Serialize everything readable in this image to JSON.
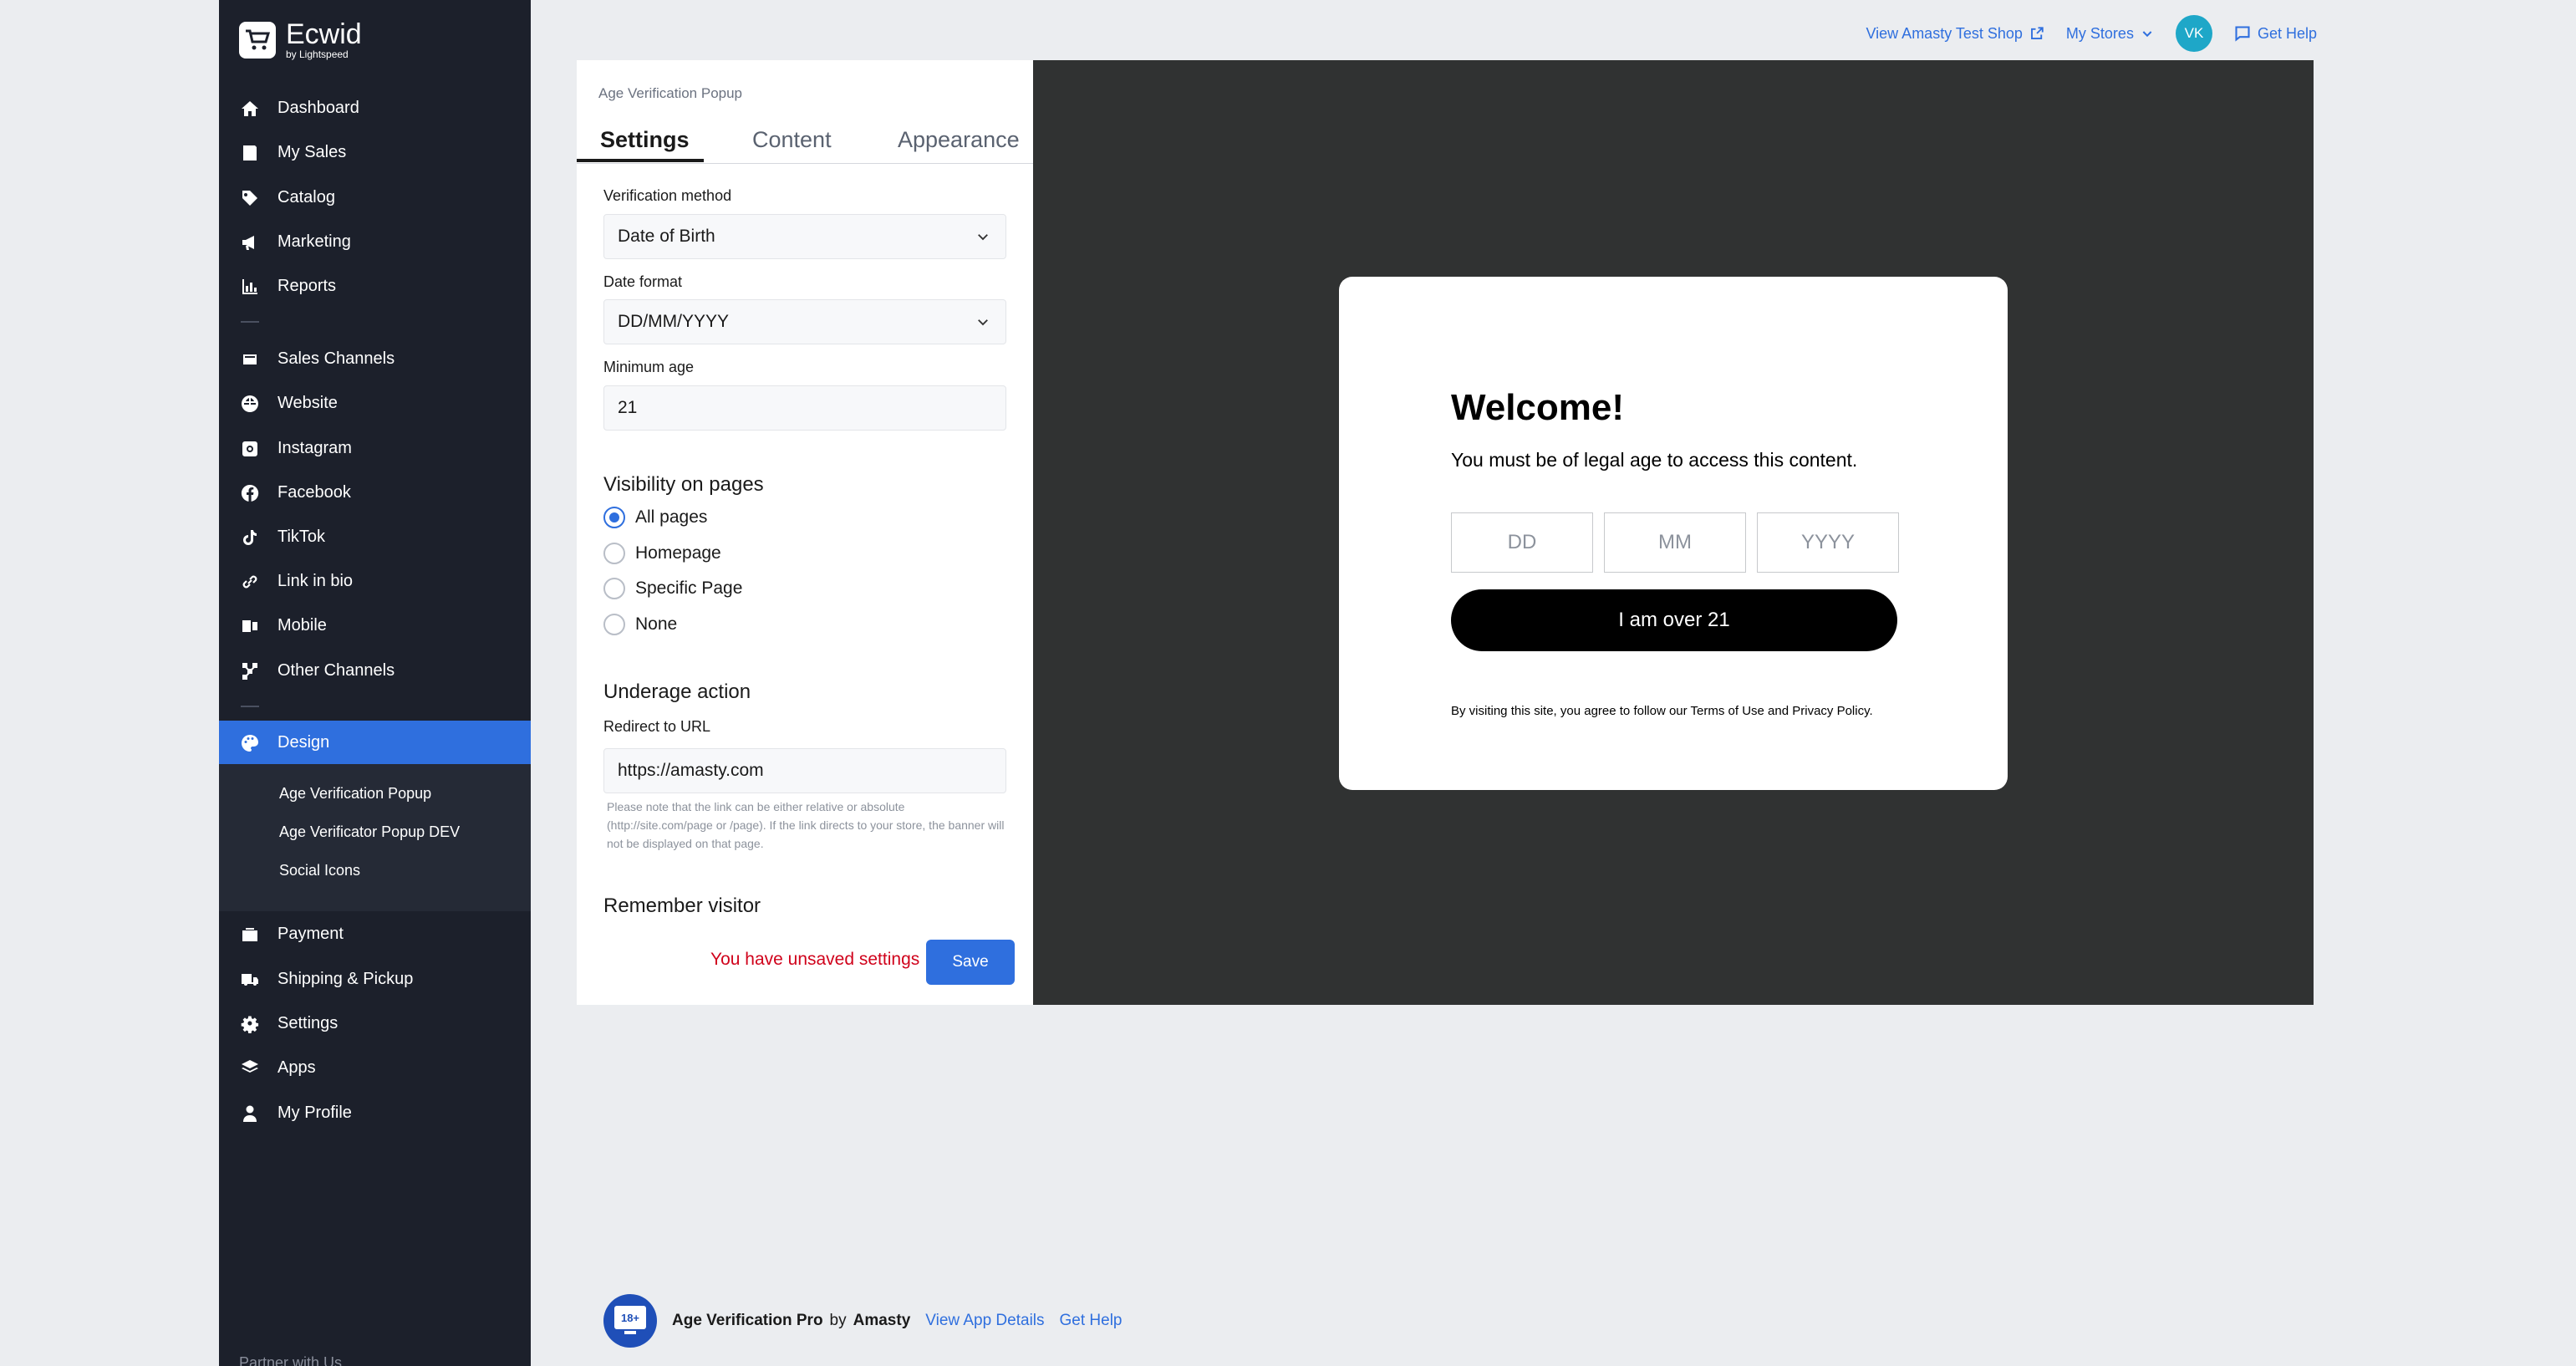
{
  "brand": {
    "name": "Ecwid",
    "sub": "by Lightspeed"
  },
  "topbar": {
    "view_shop": "View Amasty Test Shop",
    "my_stores": "My Stores",
    "avatar": "VK",
    "get_help": "Get Help"
  },
  "nav": {
    "group1": [
      "Dashboard",
      "My Sales",
      "Catalog",
      "Marketing",
      "Reports"
    ],
    "group2": [
      "Sales Channels",
      "Website",
      "Instagram",
      "Facebook",
      "TikTok",
      "Link in bio",
      "Mobile",
      "Other Channels"
    ],
    "active": "Design",
    "submenu": [
      "Age Verification Popup",
      "Age Verificator Popup DEV",
      "Social Icons"
    ],
    "group3": [
      "Payment",
      "Shipping & Pickup",
      "Settings",
      "Apps",
      "My Profile"
    ],
    "partner": "Partner with Us"
  },
  "panel": {
    "title": "Age Verification Popup",
    "tabs": [
      "Settings",
      "Content",
      "Appearance"
    ],
    "verification_label": "Verification method",
    "verification_value": "Date of Birth",
    "date_format_label": "Date format",
    "date_format_value": "DD/MM/YYYY",
    "min_age_label": "Minimum age",
    "min_age_value": "21",
    "visibility_title": "Visibility on pages",
    "visibility_options": [
      "All pages",
      "Homepage",
      "Specific Page",
      "None"
    ],
    "visibility_selected": "All pages",
    "underage_title": "Underage action",
    "redirect_label": "Redirect to URL",
    "redirect_value": "https://amasty.com",
    "hint": "Please note that the link can be either relative or absolute (http://site.com/page or /page). If the link directs to your store, the banner will not be displayed on that page.",
    "remember_title": "Remember visitor",
    "unsaved": "You have unsaved settings",
    "save": "Save"
  },
  "popup": {
    "title": "Welcome!",
    "subtitle": "You must be of legal age to access this content.",
    "placeholders": [
      "DD",
      "MM",
      "YYYY"
    ],
    "button": "I am over 21",
    "legal": "By visiting this site, you agree to follow our Terms of Use and Privacy Policy."
  },
  "footer": {
    "badge": "18+",
    "app_name": "Age Verification Pro",
    "by": "by",
    "vendor": "Amasty",
    "details": "View App Details",
    "help": "Get Help"
  },
  "colors": {
    "accent": "#2f6fde",
    "sidebar": "#1c202b",
    "preview_bg": "#303232",
    "error": "#d0021b"
  }
}
